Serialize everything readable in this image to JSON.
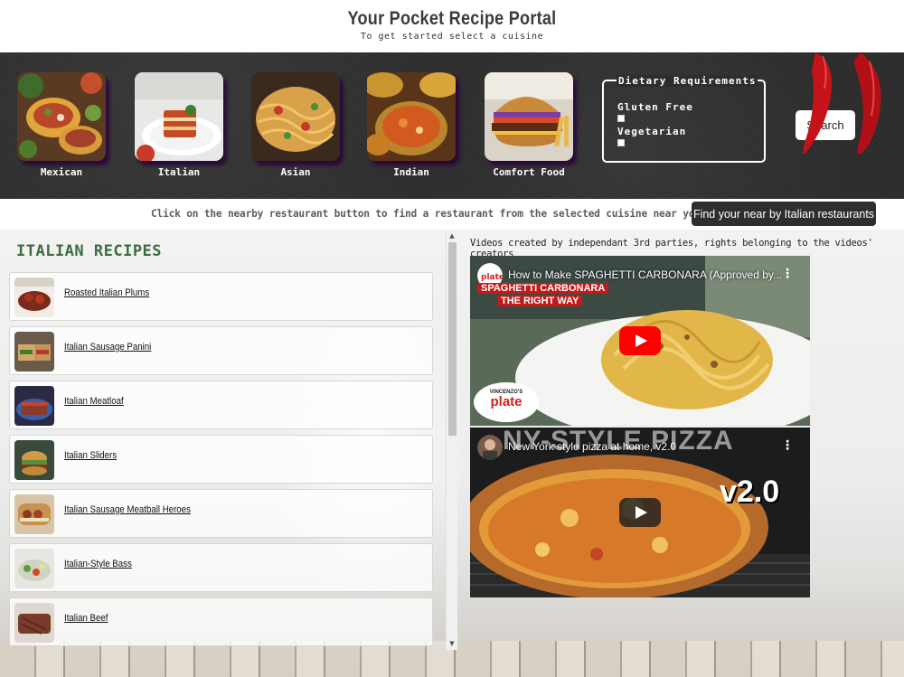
{
  "header": {
    "title": "Your Pocket Recipe Portal",
    "subtitle": "To get started select a cuisine"
  },
  "cuisines": [
    {
      "label": "Mexican",
      "icon": "tacos-photo"
    },
    {
      "label": "Italian",
      "icon": "lasagna-photo"
    },
    {
      "label": "Asian",
      "icon": "noodles-photo"
    },
    {
      "label": "Indian",
      "icon": "curry-photo"
    },
    {
      "label": "Comfort Food",
      "icon": "burger-photo"
    }
  ],
  "dietary": {
    "legend": "Dietary Requirements",
    "options": [
      {
        "label": "Gluten Free",
        "checked": false
      },
      {
        "label": "Vegetarian",
        "checked": false
      }
    ]
  },
  "search_label": "Search",
  "restaurant": {
    "instruction": "Click on the nearby restaurant button to find a restaurant from the selected cuisine near you.",
    "button_label": "Find your near by Italian restaurants"
  },
  "recipes": {
    "heading": "ITALIAN RECIPES",
    "items": [
      {
        "name": "Roasted Italian Plums"
      },
      {
        "name": "Italian Sausage Panini"
      },
      {
        "name": "Italian Meatloaf"
      },
      {
        "name": "Italian Sliders"
      },
      {
        "name": "Italian Sausage Meatball Heroes"
      },
      {
        "name": "Italian-Style Bass"
      },
      {
        "name": "Italian Beef"
      }
    ]
  },
  "videos": {
    "note": "Videos created by independant 3rd parties, rights belonging to the videos' creators",
    "items": [
      {
        "title": "How to Make SPAGHETTI CARBONARA (Approved by...",
        "overlay_line1": "SPAGHETTI CARBONARA",
        "overlay_line2": "THE RIGHT WAY",
        "badge_top": "VINCENZO'S",
        "badge_bottom": "plate"
      },
      {
        "title": "New York style pizza at home, v2.0",
        "overlay_line1": "NY-STYLE PIZZA",
        "overlay_line2": "v2.0"
      }
    ]
  },
  "colors": {
    "accent_green": "#3d6b43",
    "dark_button": "#2e2e2e",
    "youtube_red": "#ff0000"
  }
}
